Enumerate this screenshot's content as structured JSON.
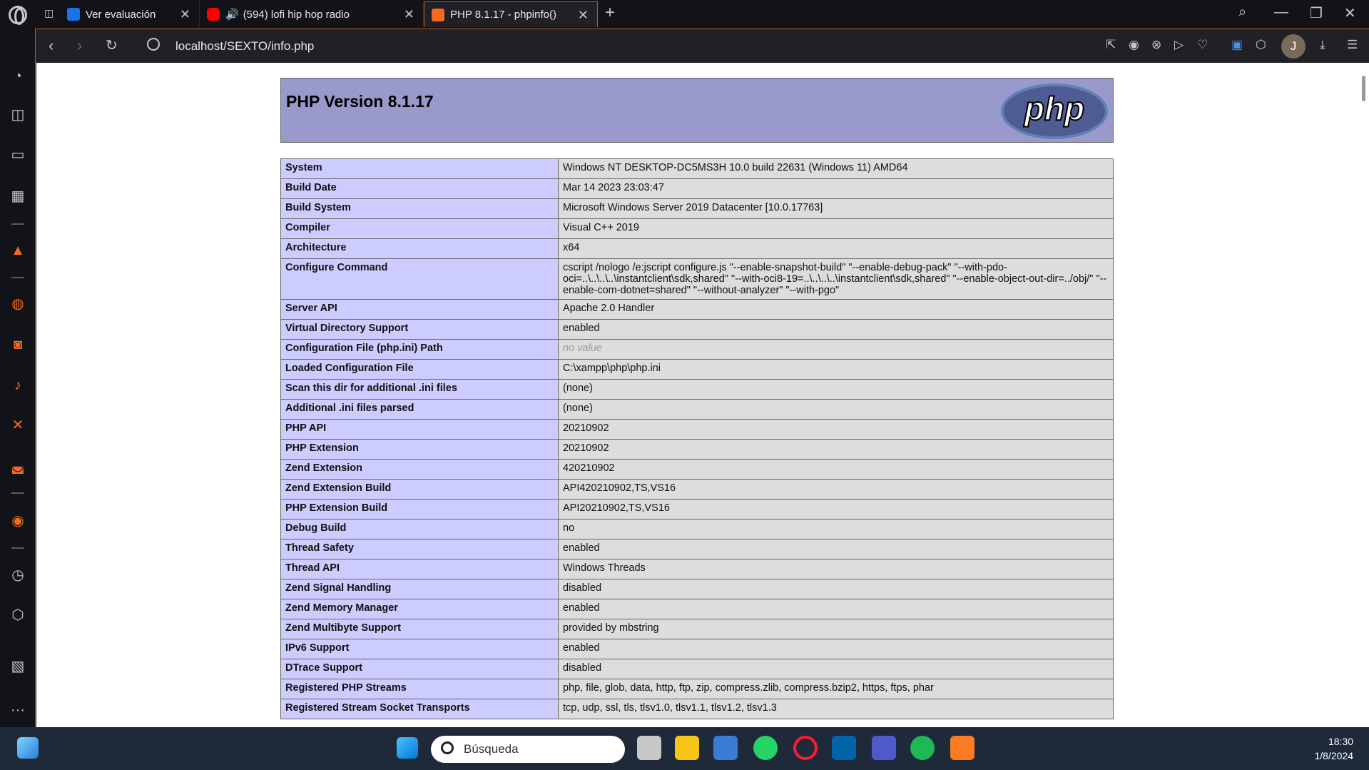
{
  "browser": {
    "tabs": [
      {
        "title": "Ver evaluación",
        "favicon_color": "#1a73e8"
      },
      {
        "title": "(594) lofi hip hop radio",
        "favicon_color": "#ff0000"
      },
      {
        "title": "PHP 8.1.17 - phpinfo()",
        "favicon_color": "#f26b21",
        "active": true
      }
    ],
    "url": "localhost/SEXTO/info.php",
    "profile_initial": "J",
    "accent_color": "#c15a1f"
  },
  "page": {
    "heading": "PHP Version 8.1.17",
    "logo_text": "php",
    "rows": [
      {
        "key": "System",
        "value": "Windows NT DESKTOP-DC5MS3H 10.0 build 22631 (Windows 11) AMD64"
      },
      {
        "key": "Build Date",
        "value": "Mar 14 2023 23:03:47"
      },
      {
        "key": "Build System",
        "value": "Microsoft Windows Server 2019 Datacenter [10.0.17763]"
      },
      {
        "key": "Compiler",
        "value": "Visual C++ 2019"
      },
      {
        "key": "Architecture",
        "value": "x64"
      },
      {
        "key": "Configure Command",
        "value": "cscript /nologo /e:jscript configure.js \"--enable-snapshot-build\" \"--enable-debug-pack\" \"--with-pdo-oci=..\\..\\..\\..\\instantclient\\sdk,shared\" \"--with-oci8-19=..\\..\\..\\..\\instantclient\\sdk,shared\" \"--enable-object-out-dir=../obj/\" \"--enable-com-dotnet=shared\" \"--without-analyzer\" \"--with-pgo\""
      },
      {
        "key": "Server API",
        "value": "Apache 2.0 Handler"
      },
      {
        "key": "Virtual Directory Support",
        "value": "enabled"
      },
      {
        "key": "Configuration File (php.ini) Path",
        "value": "no value",
        "no_value": true
      },
      {
        "key": "Loaded Configuration File",
        "value": "C:\\xampp\\php\\php.ini"
      },
      {
        "key": "Scan this dir for additional .ini files",
        "value": "(none)"
      },
      {
        "key": "Additional .ini files parsed",
        "value": "(none)"
      },
      {
        "key": "PHP API",
        "value": "20210902"
      },
      {
        "key": "PHP Extension",
        "value": "20210902"
      },
      {
        "key": "Zend Extension",
        "value": "420210902"
      },
      {
        "key": "Zend Extension Build",
        "value": "API420210902,TS,VS16"
      },
      {
        "key": "PHP Extension Build",
        "value": "API20210902,TS,VS16"
      },
      {
        "key": "Debug Build",
        "value": "no"
      },
      {
        "key": "Thread Safety",
        "value": "enabled"
      },
      {
        "key": "Thread API",
        "value": "Windows Threads"
      },
      {
        "key": "Zend Signal Handling",
        "value": "disabled"
      },
      {
        "key": "Zend Memory Manager",
        "value": "enabled"
      },
      {
        "key": "Zend Multibyte Support",
        "value": "provided by mbstring"
      },
      {
        "key": "IPv6 Support",
        "value": "enabled"
      },
      {
        "key": "DTrace Support",
        "value": "disabled"
      },
      {
        "key": "Registered PHP Streams",
        "value": "php, file, glob, data, http, ftp, zip, compress.zlib, compress.bzip2, https, ftps, phar"
      },
      {
        "key": "Registered Stream Socket Transports",
        "value": "tcp, udp, ssl, tls, tlsv1.0, tlsv1.1, tlsv1.2, tlsv1.3"
      }
    ]
  },
  "taskbar": {
    "search_placeholder": "Búsqueda",
    "time": "18:30",
    "date": "1/8/2024"
  }
}
